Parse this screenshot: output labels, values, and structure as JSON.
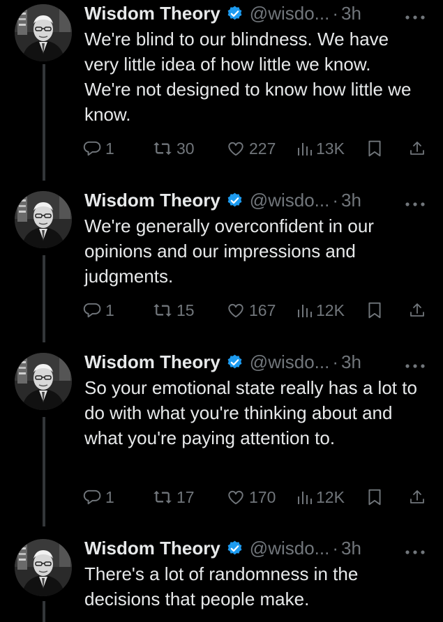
{
  "account": {
    "name": "Wisdom Theory",
    "handle": "@wisdo...",
    "separator": "·"
  },
  "colors": {
    "background": "#000000",
    "text": "#e7e9ea",
    "muted": "#71767b",
    "verified": "#1d9bf0",
    "thread_line": "#333639"
  },
  "icons": [
    "verified-badge-icon",
    "more-icon",
    "reply-icon",
    "retweet-icon",
    "like-icon",
    "views-icon",
    "bookmark-icon",
    "share-icon"
  ],
  "tweets": [
    {
      "time": "3h",
      "text": "We're blind to our blindness. We have very little idea of how little we know. We're not designed to know how little we know.",
      "replies": "1",
      "retweets": "30",
      "likes": "227",
      "views": "13K"
    },
    {
      "time": "3h",
      "text": "We're generally overconfident in our opinions and our impressions and judgments.",
      "replies": "1",
      "retweets": "15",
      "likes": "167",
      "views": "12K"
    },
    {
      "time": "3h",
      "text": "So your emotional state really has a lot to do with what you're thinking about and what you're paying attention to.",
      "replies": "1",
      "retweets": "17",
      "likes": "170",
      "views": "12K"
    },
    {
      "time": "3h",
      "text": "There's a lot of randomness in the decisions that people make."
    }
  ]
}
